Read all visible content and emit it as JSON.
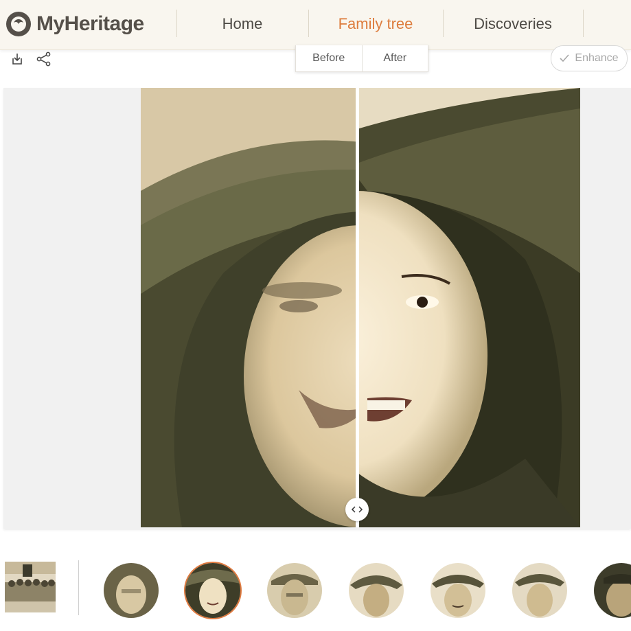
{
  "brand": {
    "name": "MyHeritage"
  },
  "nav": [
    {
      "label": "Home",
      "active": false
    },
    {
      "label": "Family tree",
      "active": true
    },
    {
      "label": "Discoveries",
      "active": false
    }
  ],
  "toolbar": {
    "download_icon": "download-icon",
    "share_icon": "share-icon",
    "toggle": {
      "before_label": "Before",
      "after_label": "After"
    },
    "enhance_label": "Enhance"
  },
  "viewer": {
    "compare_handle_icon": "chevrons-left-right-icon"
  },
  "thumbnails": {
    "group_photo": "group-photo",
    "faces_count": 7,
    "selected_face_index": 1
  },
  "colors": {
    "accent": "#dd7c3d",
    "header_bg": "#f9f6ef",
    "viewer_bg": "#f1f1f1"
  }
}
